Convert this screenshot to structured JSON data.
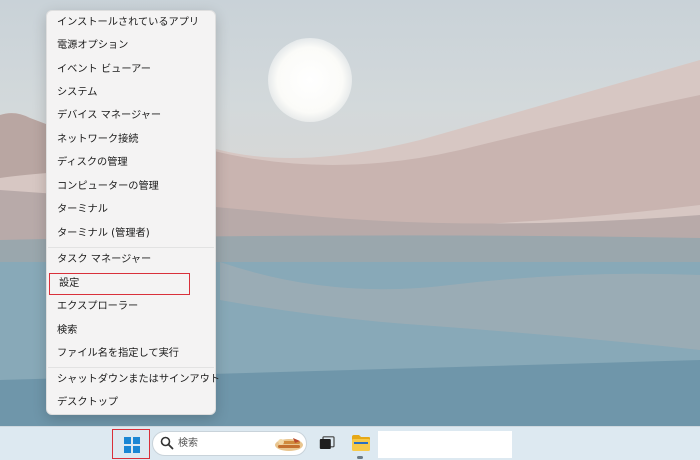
{
  "context_menu": {
    "items": [
      {
        "label": "インストールされているアプリ"
      },
      {
        "label": "電源オプション"
      },
      {
        "label": "イベント ビューアー"
      },
      {
        "label": "システム"
      },
      {
        "label": "デバイス マネージャー"
      },
      {
        "label": "ネットワーク接続"
      },
      {
        "label": "ディスクの管理"
      },
      {
        "label": "コンピューターの管理"
      },
      {
        "label": "ターミナル"
      },
      {
        "label": "ターミナル (管理者)"
      },
      {
        "label": "タスク マネージャー"
      },
      {
        "label": "設定"
      },
      {
        "label": "エクスプローラー"
      },
      {
        "label": "検索"
      },
      {
        "label": "ファイル名を指定して実行"
      },
      {
        "label": "シャットダウンまたはサインアウト",
        "submenu_indicator": "›"
      },
      {
        "label": "デスクトップ"
      }
    ],
    "highlighted_item": "設定",
    "highlight_color": "#d9303a"
  },
  "taskbar": {
    "search": {
      "label": "検索"
    },
    "icons": [
      "windows-logo-icon",
      "search-icon",
      "search-highlight-icon",
      "task-view-icon",
      "file-explorer-icon"
    ],
    "accent_color": "#1a86d4"
  },
  "desktop": {
    "wallpaper": "desert-dunes-lake"
  }
}
